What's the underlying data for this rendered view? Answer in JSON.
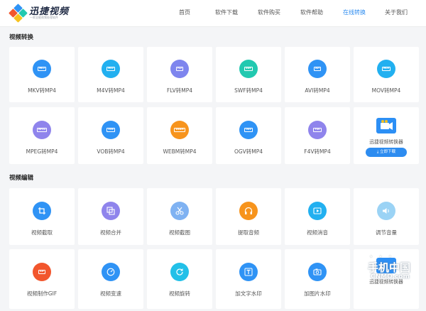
{
  "header": {
    "brand": "迅捷视频",
    "tagline": "一款全能视频处理软件",
    "nav": [
      "首页",
      "软件下载",
      "软件购买",
      "软件帮助",
      "在线转换",
      "关于我们"
    ],
    "active_nav": "在线转换"
  },
  "convert": {
    "title": "视频转换",
    "items": [
      {
        "label": "MKV转MP4",
        "badge": "MKV",
        "color": "#2f93f5"
      },
      {
        "label": "M4V转MP4",
        "badge": "M4V",
        "color": "#22b0f0"
      },
      {
        "label": "FLV转MP4",
        "badge": "FLV",
        "color": "#7e85ee"
      },
      {
        "label": "SWF转MP4",
        "badge": "SWF",
        "color": "#22c9b0"
      },
      {
        "label": "AVI转MP4",
        "badge": "AVI",
        "color": "#2f93f5"
      },
      {
        "label": "MOV转MP4",
        "badge": "MOV",
        "color": "#22b0f0"
      },
      {
        "label": "MPEG转MP4",
        "badge": "MPEG",
        "color": "#8f84ec"
      },
      {
        "label": "VOB转MP4",
        "badge": "VOB",
        "color": "#2f93f5"
      },
      {
        "label": "WEBM转MP4",
        "badge": "WEBM",
        "color": "#f7941d"
      },
      {
        "label": "OGV转MP4",
        "badge": "OGV",
        "color": "#2f93f5"
      },
      {
        "label": "F4V转MP4",
        "badge": "F4V",
        "color": "#8f84ec"
      }
    ],
    "promo": {
      "label": "迅捷视频转换器",
      "button": "立即下载"
    }
  },
  "edit": {
    "title": "视频编辑",
    "items": [
      {
        "label": "视频截取",
        "icon": "crop-icon",
        "color": "#2f93f5"
      },
      {
        "label": "视频合并",
        "icon": "merge-icon",
        "color": "#8f84ec"
      },
      {
        "label": "视频截图",
        "icon": "scissors-icon",
        "color": "#7fb2f2"
      },
      {
        "label": "提取音频",
        "icon": "headphones-icon",
        "color": "#f7941d"
      },
      {
        "label": "视频消音",
        "icon": "video-play-icon",
        "color": "#22b0f0"
      },
      {
        "label": "调节音量",
        "icon": "volume-icon",
        "color": "#9bd3f5"
      },
      {
        "label": "视频制作GIF",
        "icon": "gif-icon",
        "color": "#f2562d"
      },
      {
        "label": "视频变速",
        "icon": "speedometer-icon",
        "color": "#2f93f5"
      },
      {
        "label": "视频旋转",
        "icon": "rotate-icon",
        "color": "#22c0e8"
      },
      {
        "label": "加文字水印",
        "icon": "text-watermark-icon",
        "color": "#2f93f5"
      },
      {
        "label": "加图片水印",
        "icon": "image-watermark-icon",
        "color": "#2f93f5"
      }
    ],
    "promo_label": "迅捷视频转换器"
  },
  "watermark": {
    "line1": "手机中国",
    "line2": "CNMO.com"
  }
}
